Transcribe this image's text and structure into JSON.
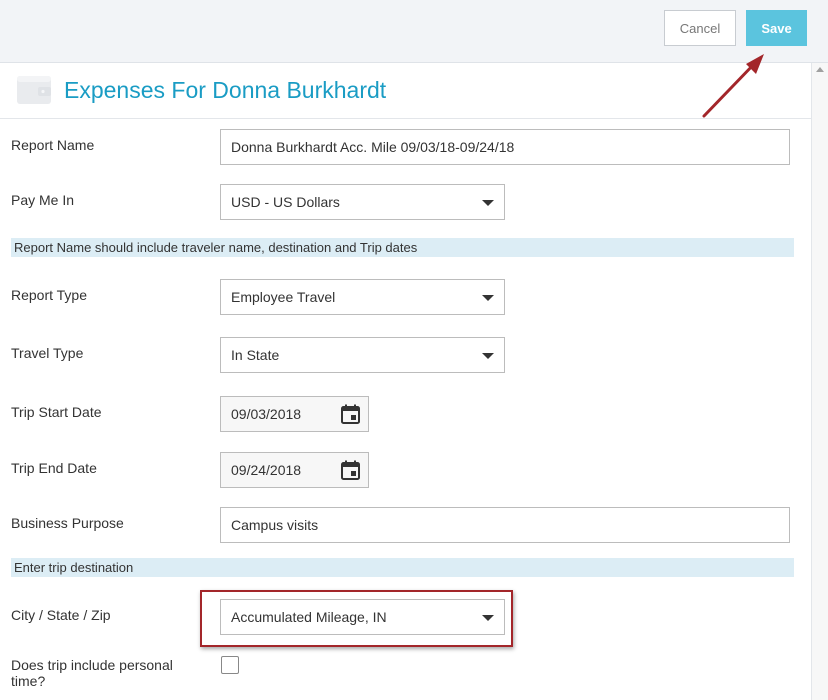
{
  "toolbar": {
    "cancel_label": "Cancel",
    "save_label": "Save"
  },
  "header": {
    "title": "Expenses For Donna Burkhardt"
  },
  "form": {
    "report_name": {
      "label": "Report Name",
      "value": "Donna Burkhardt Acc. Mile 09/03/18-09/24/18"
    },
    "pay_me_in": {
      "label": "Pay Me In",
      "value": "USD - US Dollars"
    },
    "report_name_hint": "Report Name should include traveler name, destination and Trip dates",
    "report_type": {
      "label": "Report Type",
      "value": "Employee Travel"
    },
    "travel_type": {
      "label": "Travel Type",
      "value": "In State"
    },
    "trip_start_date": {
      "label": "Trip Start Date",
      "value": "09/03/2018"
    },
    "trip_end_date": {
      "label": "Trip End Date",
      "value": "09/24/2018"
    },
    "business_purpose": {
      "label": "Business Purpose",
      "value": "Campus visits"
    },
    "destination_hint": "Enter trip destination",
    "city_state_zip": {
      "label": "City / State / Zip",
      "value": "Accumulated Mileage, IN"
    },
    "personal_time": {
      "label_line1": "Does trip include personal",
      "label_line2": "time?",
      "checked": false
    }
  },
  "colors": {
    "accent": "#1a9cc4",
    "save_button": "#5bc4de",
    "banner": "#dcedf5",
    "annotation": "#a3262a"
  },
  "icons": {
    "header": "wallet-icon",
    "date": "calendar-icon",
    "dropdown": "chevron-down-icon"
  }
}
